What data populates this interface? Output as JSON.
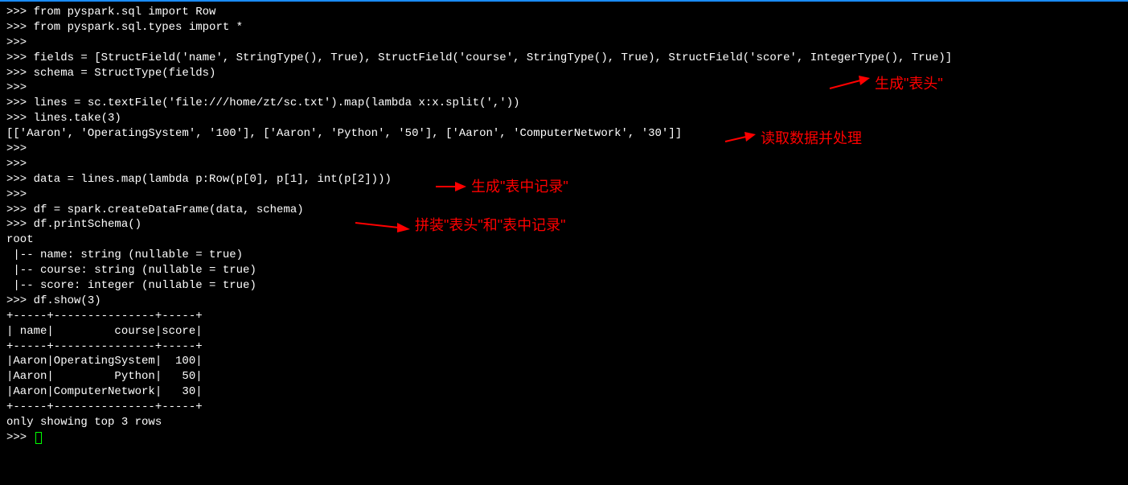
{
  "terminal": {
    "lines": [
      ">>> from pyspark.sql import Row",
      ">>> from pyspark.sql.types import *",
      ">>> ",
      ">>> fields = [StructField('name', StringType(), True), StructField('course', StringType(), True), StructField('score', IntegerType(), True)]",
      ">>> schema = StructType(fields)",
      ">>> ",
      ">>> lines = sc.textFile('file:///home/zt/sc.txt').map(lambda x:x.split(','))",
      ">>> lines.take(3)",
      "[['Aaron', 'OperatingSystem', '100'], ['Aaron', 'Python', '50'], ['Aaron', 'ComputerNetwork', '30']]",
      ">>> ",
      ">>> ",
      ">>> data = lines.map(lambda p:Row(p[0], p[1], int(p[2])))",
      ">>> ",
      ">>> df = spark.createDataFrame(data, schema)",
      ">>> df.printSchema()",
      "root",
      " |-- name: string (nullable = true)",
      " |-- course: string (nullable = true)",
      " |-- score: integer (nullable = true)",
      "",
      ">>> df.show(3)",
      "+-----+---------------+-----+",
      "| name|         course|score|",
      "+-----+---------------+-----+",
      "|Aaron|OperatingSystem|  100|",
      "|Aaron|         Python|   50|",
      "|Aaron|ComputerNetwork|   30|",
      "+-----+---------------+-----+",
      "only showing top 3 rows",
      "",
      ">>> "
    ]
  },
  "annotations": {
    "a1": "生成\"表头\"",
    "a2": "读取数据并处理",
    "a3": "生成\"表中记录\"",
    "a4": "拼装\"表头\"和\"表中记录\""
  }
}
